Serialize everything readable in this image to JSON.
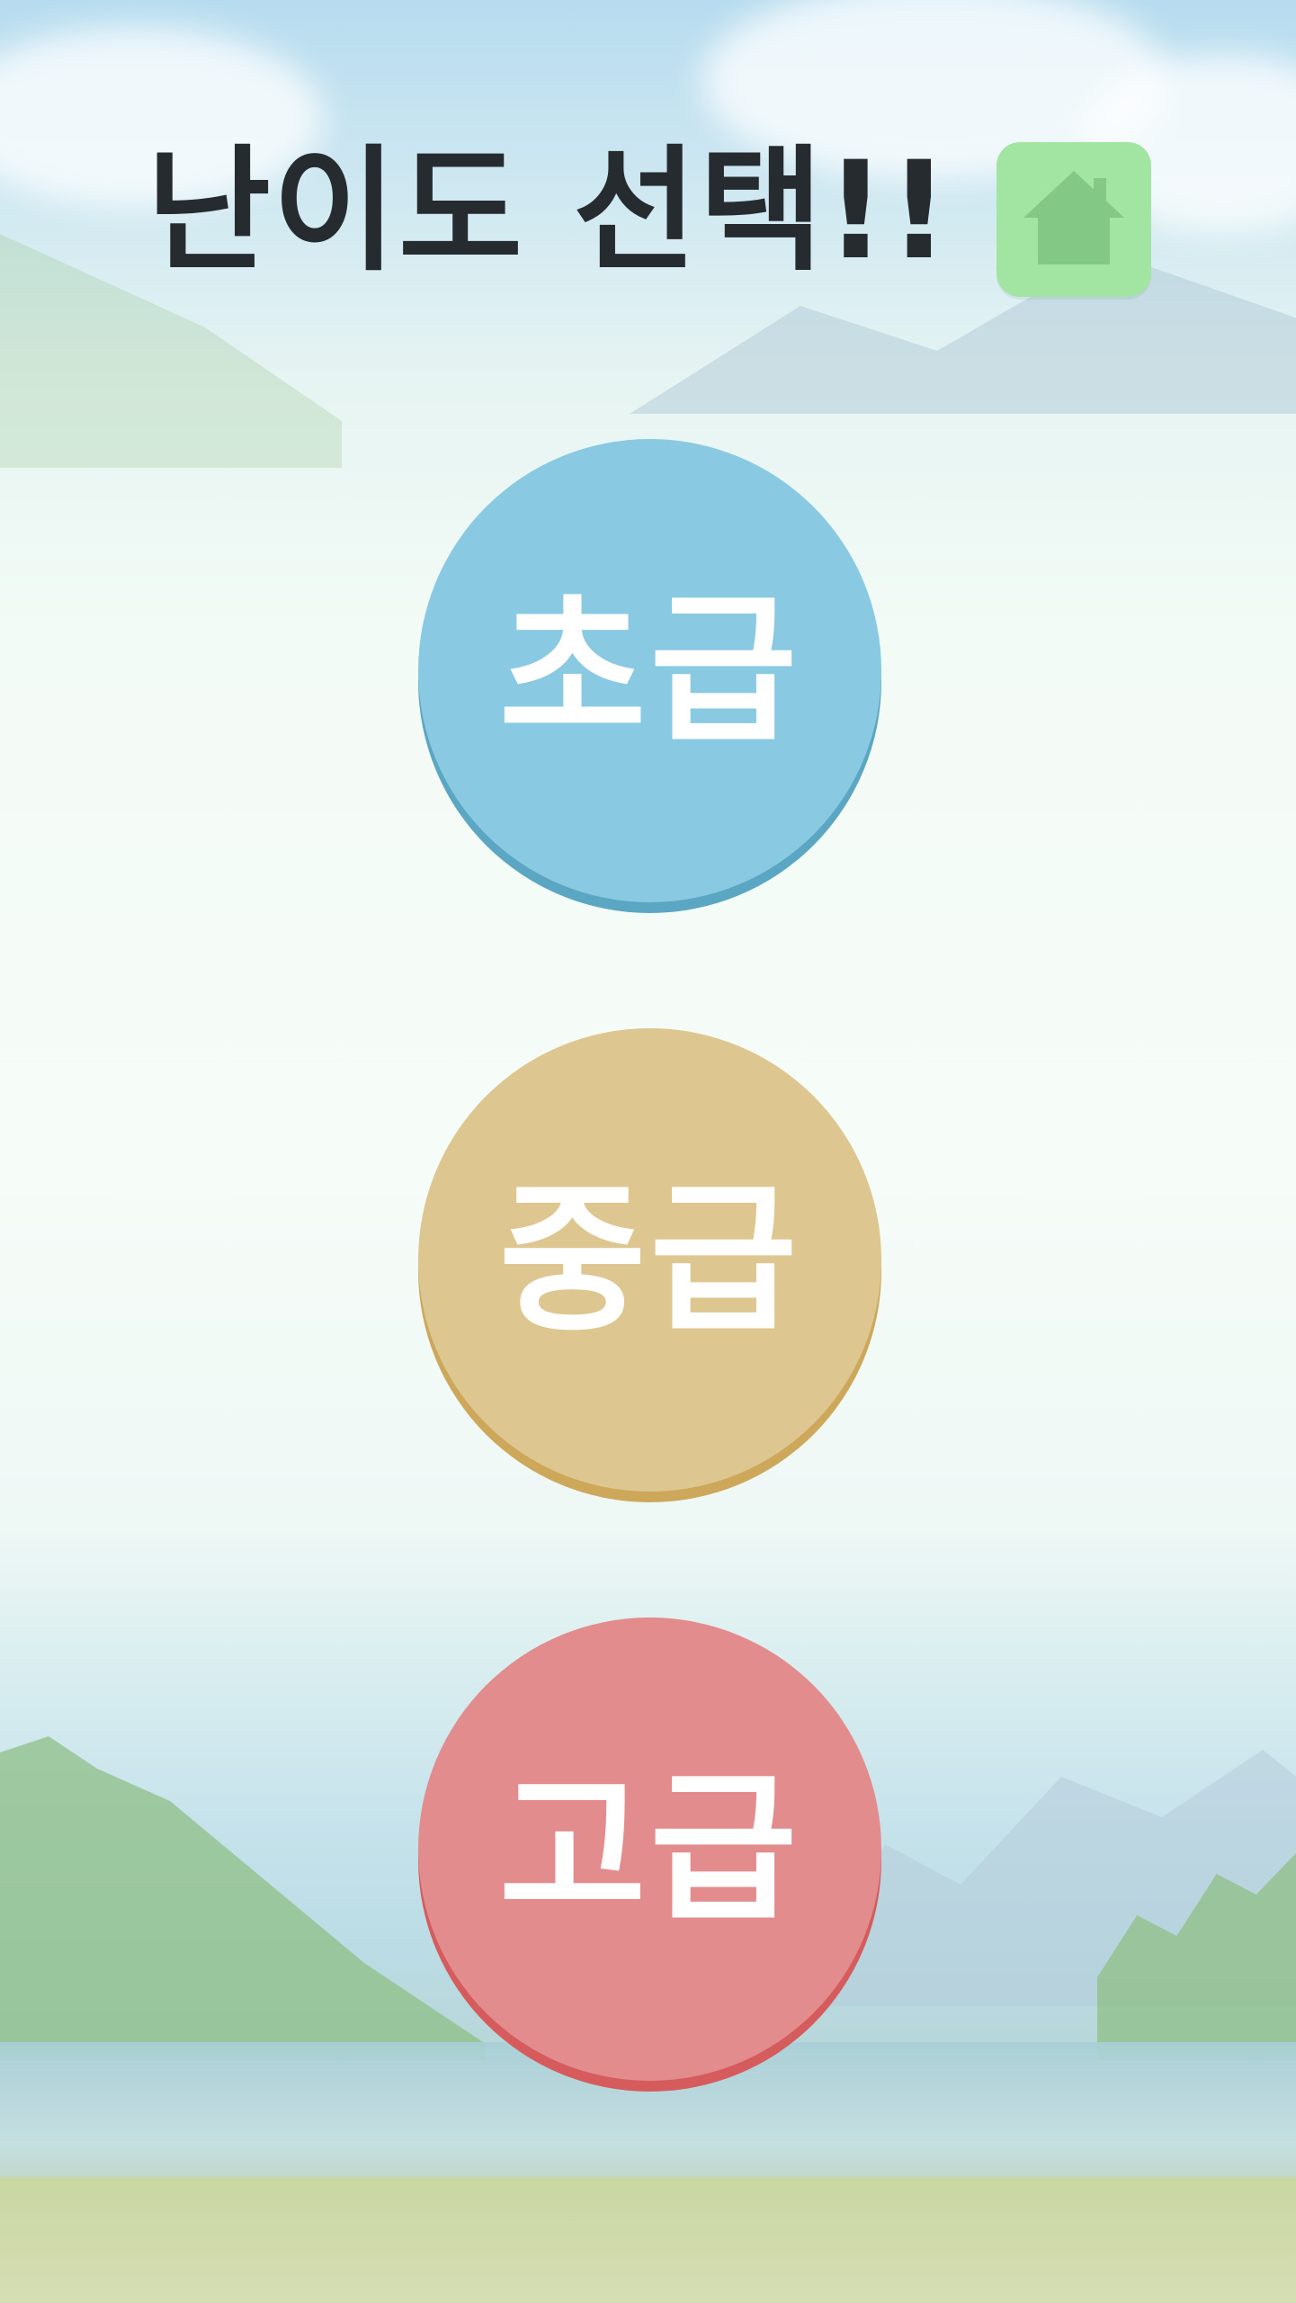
{
  "header": {
    "title": "난이도 선택!!",
    "home_icon": "home-icon"
  },
  "levels": [
    {
      "label": "초급",
      "color": "#89c9e2"
    },
    {
      "label": "중급",
      "color": "#ddc690"
    },
    {
      "label": "고급",
      "color": "#e38c8d"
    }
  ],
  "colors": {
    "title_text": "#262b30",
    "home_button": "#a2e4a1",
    "home_icon": "#84c886",
    "button_text": "#ffffff"
  }
}
